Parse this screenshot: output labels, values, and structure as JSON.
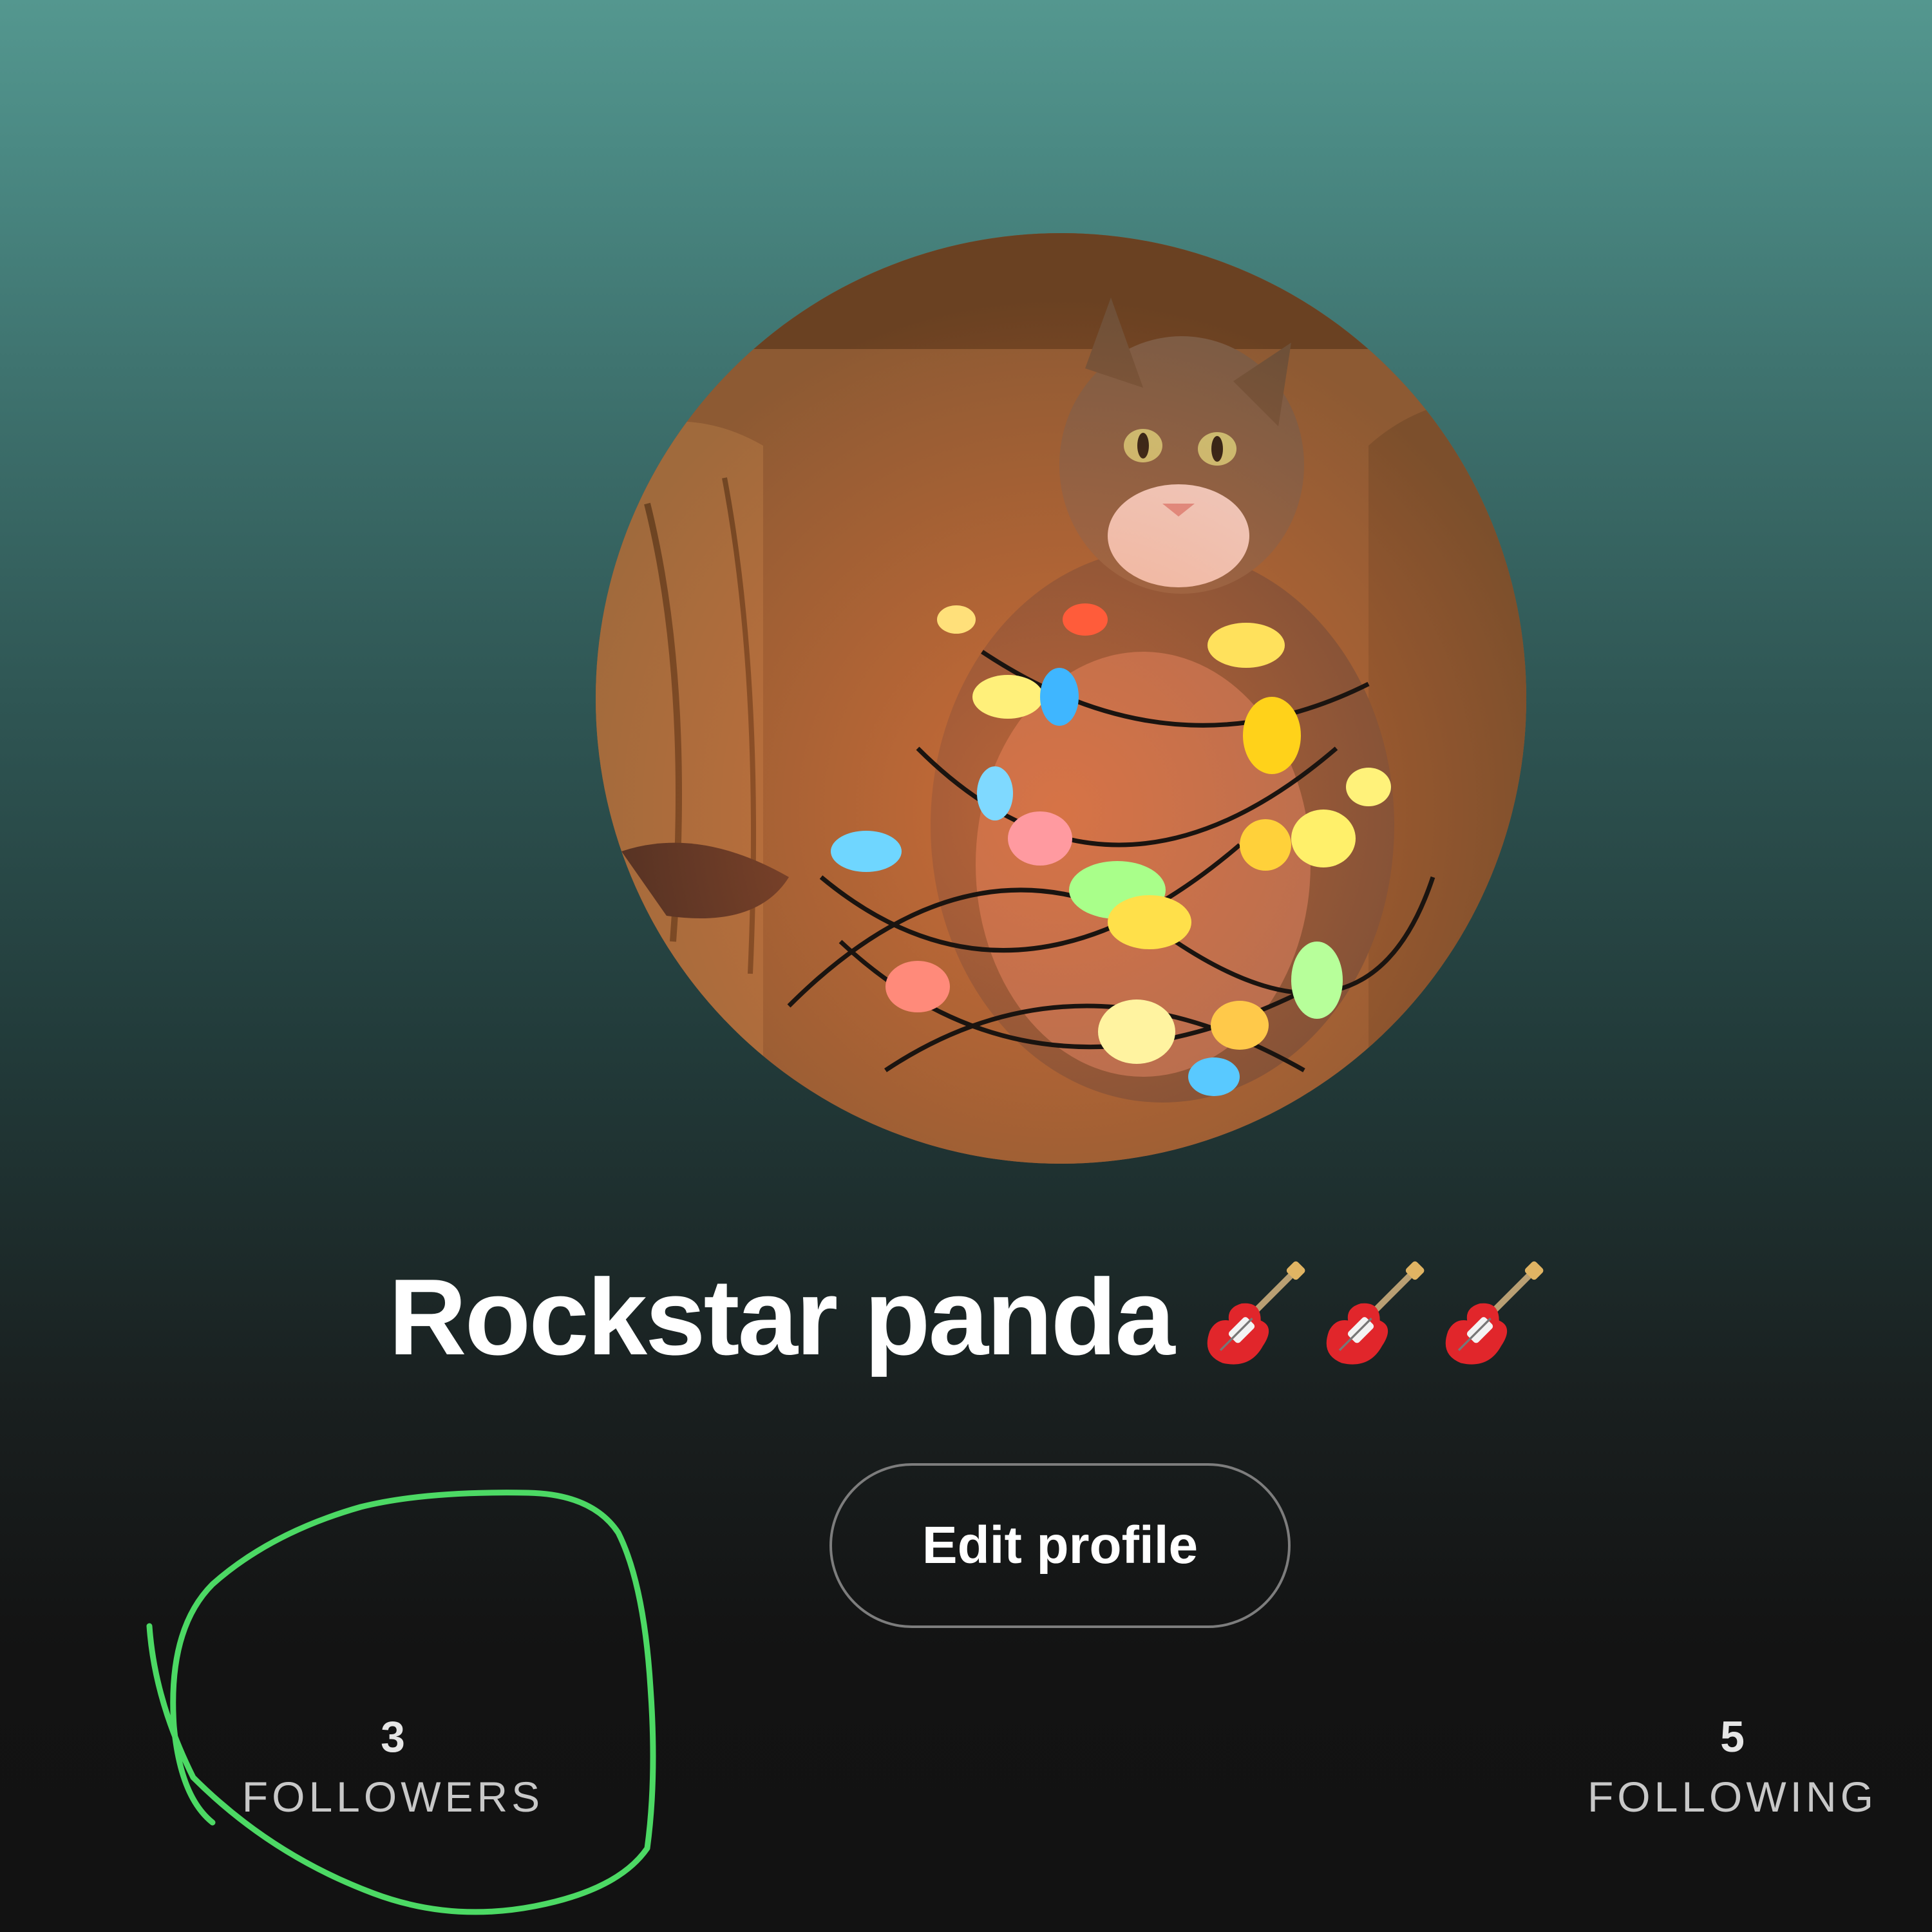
{
  "profile": {
    "display_name": "Rockstar panda",
    "name_emoji_icon": "guitar-icon",
    "name_emoji_count": 3,
    "avatar_description": "cat-with-christmas-lights-photo",
    "edit_button_label": "Edit profile"
  },
  "stats": {
    "followers_count": "3",
    "followers_label": "FOLLOWERS",
    "following_count": "5",
    "following_label": "FOLLOWING"
  },
  "colors": {
    "gradient_top": "#54978f",
    "gradient_bottom": "#121212",
    "annotation_green": "#4cd964",
    "button_border": "#7d7d7d"
  }
}
